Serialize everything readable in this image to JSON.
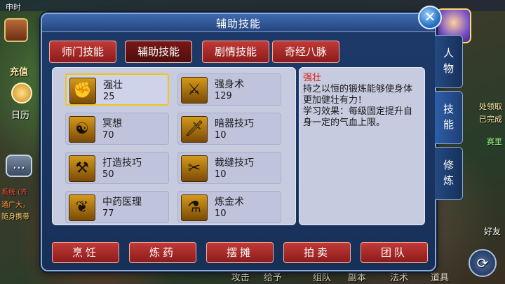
{
  "hud": {
    "time": "申时",
    "recharge": "充值",
    "calendar": "日历",
    "chat_lines": [
      "系统 (齐",
      "通广大，",
      "随身携带"
    ],
    "quest_lines": [
      "处领取",
      "已完成",
      "赛里"
    ],
    "friends": "好友",
    "bottom_items": [
      "攻击",
      "给予",
      "组队",
      "副本",
      "法术",
      "道具"
    ]
  },
  "dialog": {
    "title": "辅助技能",
    "close_label": "✕",
    "top_tabs": [
      "师门技能",
      "辅助技能",
      "剧情技能",
      "奇经八脉"
    ],
    "active_top_tab": 1,
    "side_tabs": [
      {
        "label": "人\n物"
      },
      {
        "label": "技\n能"
      },
      {
        "label": "修\n炼"
      }
    ],
    "skills": [
      {
        "name": "强壮",
        "level": "25",
        "icon": "flex-strength-icon",
        "glyph": "✊"
      },
      {
        "name": "强身术",
        "level": "129",
        "icon": "body-training-icon",
        "glyph": "⚔"
      },
      {
        "name": "冥想",
        "level": "70",
        "icon": "meditation-icon",
        "glyph": "☯"
      },
      {
        "name": "暗器技巧",
        "level": "10",
        "icon": "throwing-dagger-icon",
        "glyph": "🗡"
      },
      {
        "name": "打造技巧",
        "level": "50",
        "icon": "hammer-forge-icon",
        "glyph": "⚒"
      },
      {
        "name": "裁缝技巧",
        "level": "10",
        "icon": "scissors-tailor-icon",
        "glyph": "✂"
      },
      {
        "name": "中药医理",
        "level": "77",
        "icon": "herb-medicine-icon",
        "glyph": "❦"
      },
      {
        "name": "炼金术",
        "level": "10",
        "icon": "alchemy-icon",
        "glyph": "⚗"
      }
    ],
    "selected_skill_index": 0,
    "description": {
      "title": "强壮",
      "text": "持之以恒的锻炼能够使身体更加健壮有力！",
      "effect": "学习效果：每级固定提升自身一定的气血上限。"
    },
    "bottom_buttons": [
      "烹饪",
      "炼药",
      "摆摊",
      "拍卖",
      "团队"
    ]
  }
}
